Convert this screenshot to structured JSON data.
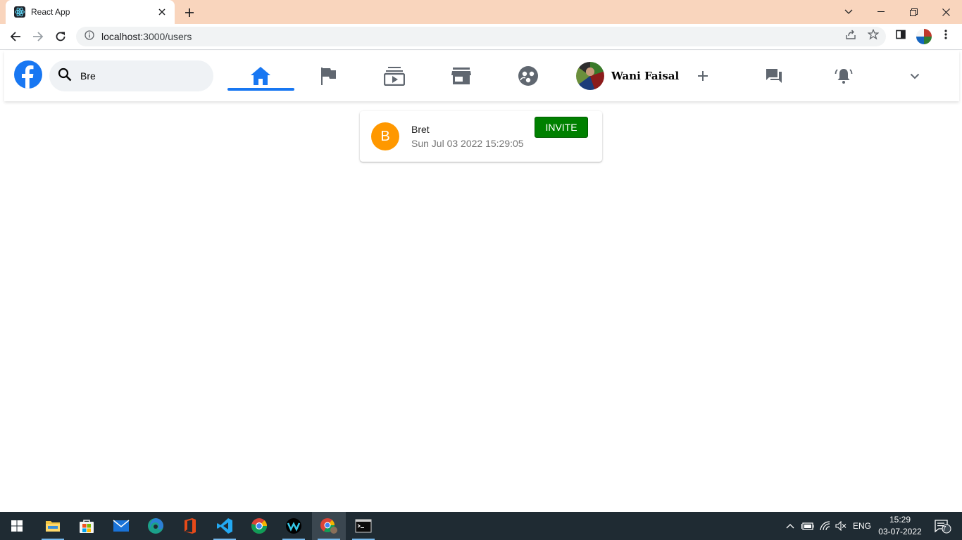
{
  "browser": {
    "tab_title": "React App",
    "url_host": "localhost",
    "url_path": ":3000/users"
  },
  "header": {
    "search_value": "Bre",
    "active_nav": "home",
    "nav_icons": [
      "home-icon",
      "flag-icon",
      "subscriptions-icon",
      "storefront-icon",
      "groups-icon"
    ],
    "user_name": "Wani Faisal",
    "action_icons": [
      "add-icon",
      "forum-icon",
      "notifications-active-icon",
      "expand-more-icon"
    ],
    "accent_color": "#1877f2"
  },
  "results": [
    {
      "initial": "B",
      "name": "Bret",
      "date": "Sun Jul 03 2022 15:29:05",
      "action_label": "INVITE",
      "avatar_color": "#ff9800",
      "action_color": "#008000"
    }
  ],
  "taskbar": {
    "apps": [
      "windows-start-icon",
      "file-explorer-icon",
      "microsoft-store-icon",
      "mail-icon",
      "edge-icon",
      "office-icon",
      "vscode-icon",
      "chrome-icon",
      "webex-icon",
      "chrome-profile-icon",
      "terminal-icon"
    ],
    "language": "ENG",
    "time": "15:29",
    "date": "03-07-2022",
    "notification_count": "7"
  }
}
